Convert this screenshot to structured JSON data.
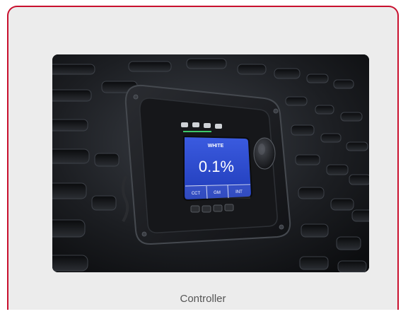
{
  "card": {
    "caption": "Controller",
    "border_color": "#c8102e",
    "background": "#ececec"
  },
  "photo": {
    "screen": {
      "title": "WHITE",
      "value": "0.1%",
      "soft_keys": [
        "CCT",
        "GM",
        "INT"
      ],
      "accent_color": "#2f4fd6"
    }
  }
}
